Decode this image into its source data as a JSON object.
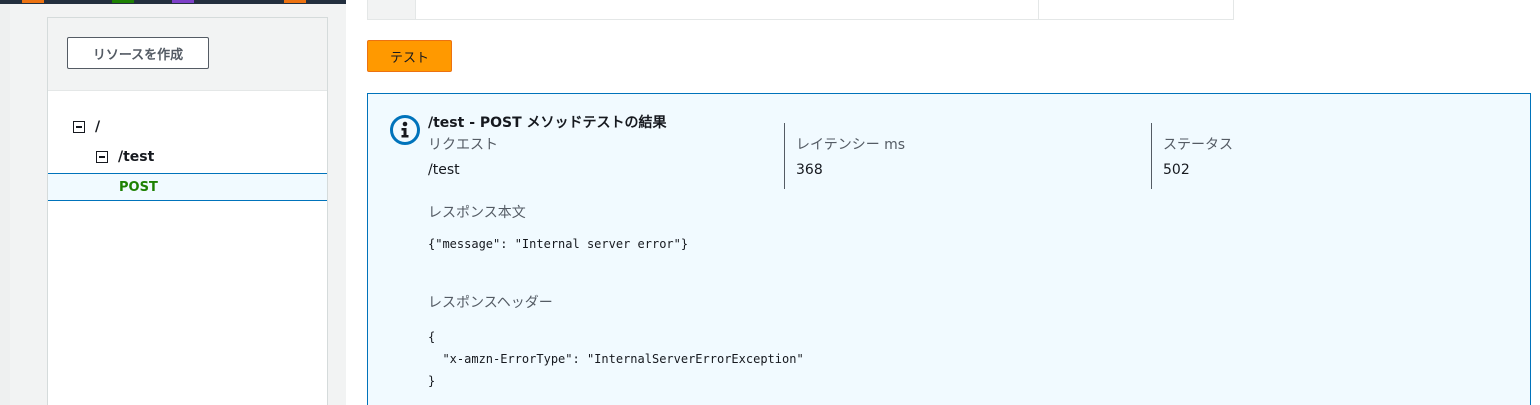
{
  "window": {
    "tab_marks": [
      {
        "color": "#ec7211"
      },
      {
        "color": "#1d8102"
      },
      {
        "color": "#7d3fc8"
      },
      {
        "color": "#ec7211"
      },
      {
        "color": "#7d3fc8"
      },
      {
        "color": "#3f51c8"
      },
      {
        "color": "#ec7211"
      },
      {
        "color": "#7d3fc8"
      },
      {
        "color": "#ec7211"
      },
      {
        "color": "#3f51c8"
      },
      {
        "color": "#7d3fc8"
      },
      {
        "color": "#1d8102"
      }
    ]
  },
  "sidebar": {
    "create_resource_label": "リソースを作成",
    "tree": [
      {
        "label": "/",
        "icon": "collapse-icon"
      },
      {
        "label": "/test",
        "icon": "collapse-icon"
      },
      {
        "label": "POST",
        "method": true,
        "selected": true
      }
    ]
  },
  "main": {
    "test_button_label": "テスト",
    "result": {
      "icon": "info-icon",
      "title": "/test - POST メソッドテストの結果",
      "request_label": "リクエスト",
      "request_value": "/test",
      "latency_label": "レイテンシー ms",
      "latency_value": "368",
      "status_label": "ステータス",
      "status_value": "502",
      "body_label": "レスポンス本文",
      "body_value": "{\"message\": \"Internal server error\"}",
      "headers_label": "レスポンスヘッダー",
      "headers_value": "{\n  \"x-amzn-ErrorType\": \"InternalServerErrorException\"\n}"
    }
  },
  "colors": {
    "accent_orange": "#ff9900",
    "info_blue": "#0073bb",
    "method_green": "#1d8102"
  }
}
